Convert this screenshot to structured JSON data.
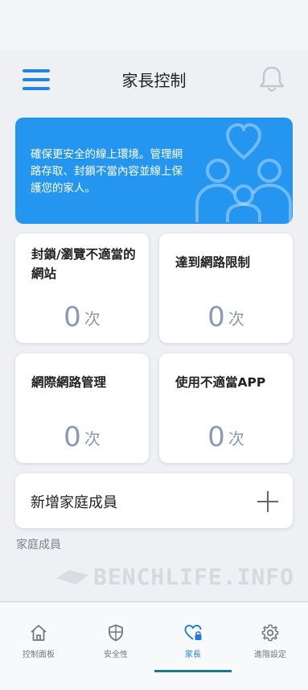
{
  "header": {
    "title": "家長控制"
  },
  "banner": {
    "text": "確保更安全的線上環境。管理網路存取、封鎖不當內容並線上保護您的家人。"
  },
  "stats": [
    {
      "title": "封鎖/瀏覽不適當的網站",
      "count": "0",
      "unit": "次"
    },
    {
      "title": "達到網路限制",
      "count": "0",
      "unit": "次"
    },
    {
      "title": "網際網路管理",
      "count": "0",
      "unit": "次"
    },
    {
      "title": "使用不適當APP",
      "count": "0",
      "unit": "次"
    }
  ],
  "add_member": {
    "label": "新增家庭成員"
  },
  "members_section": {
    "label": "家庭成員"
  },
  "watermark": "BENCHLIFE.INFO",
  "tabs": [
    {
      "label": "控制面板",
      "icon": "home-icon"
    },
    {
      "label": "安全性",
      "icon": "shield-icon"
    },
    {
      "label": "家長",
      "icon": "heart-lock-icon",
      "active": true
    },
    {
      "label": "進階設定",
      "icon": "gear-icon"
    }
  ],
  "colors": {
    "accent": "#2596ef",
    "tab_underline": "#1a7a8a",
    "count": "#8a9ab0"
  }
}
